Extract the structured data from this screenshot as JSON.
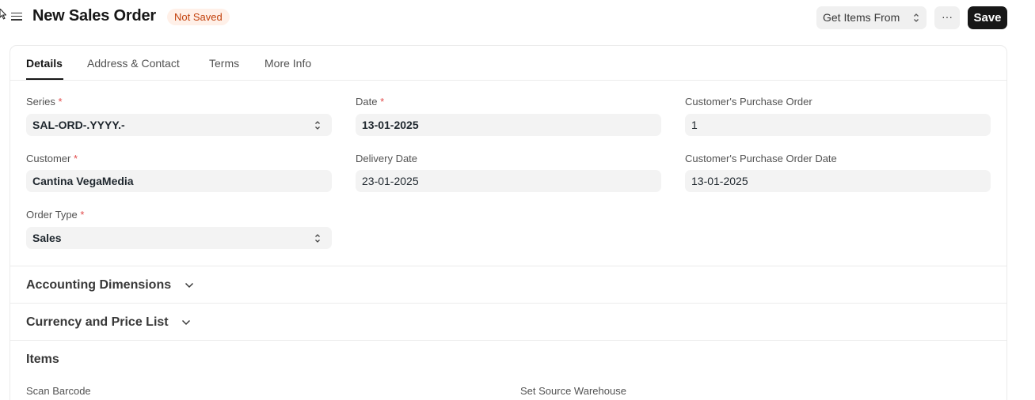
{
  "header": {
    "title": "New Sales Order",
    "status_badge": "Not Saved",
    "get_items_label": "Get Items From",
    "more_label": "···",
    "save_label": "Save"
  },
  "tabs": [
    {
      "label": "Details",
      "active": true
    },
    {
      "label": "Address & Contact",
      "active": false
    },
    {
      "label": "Terms",
      "active": false
    },
    {
      "label": "More Info",
      "active": false
    }
  ],
  "fields": {
    "series": {
      "label": "Series",
      "required": "*",
      "value": "SAL-ORD-.YYYY.-"
    },
    "date": {
      "label": "Date",
      "required": "*",
      "value": "13-01-2025"
    },
    "customer_po": {
      "label": "Customer's Purchase Order",
      "value": "1"
    },
    "customer": {
      "label": "Customer",
      "required": "*",
      "value": "Cantina VegaMedia"
    },
    "delivery_date": {
      "label": "Delivery Date",
      "value": "23-01-2025"
    },
    "customer_po_date": {
      "label": "Customer's Purchase Order Date",
      "value": "13-01-2025"
    },
    "order_type": {
      "label": "Order Type",
      "required": "*",
      "value": "Sales"
    }
  },
  "sections": {
    "accounting": "Accounting Dimensions",
    "currency": "Currency and Price List",
    "items": "Items"
  },
  "items_fields": {
    "scan_barcode": "Scan Barcode",
    "source_warehouse": "Set Source Warehouse"
  },
  "colors": {
    "accent": "#171717",
    "badge_bg": "#fff0e8",
    "badge_text": "#c2410c",
    "required": "#e24c4c",
    "input_bg": "#f3f3f3"
  }
}
